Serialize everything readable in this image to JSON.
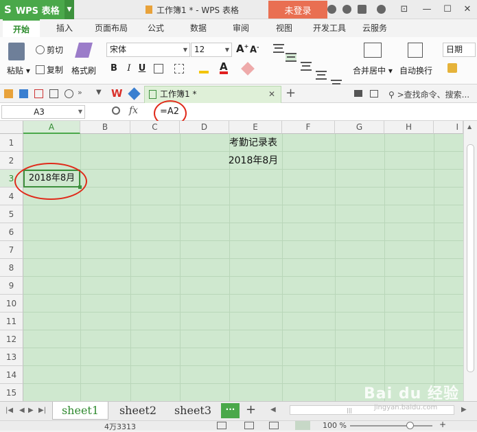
{
  "app": {
    "name": "WPS 表格",
    "logo_glyph": "S",
    "document_title": "工作簿1 * - WPS 表格",
    "login_label": "未登录"
  },
  "menu_tabs": [
    "开始",
    "插入",
    "页面布局",
    "公式",
    "数据",
    "审阅",
    "视图",
    "开发工具",
    "云服务"
  ],
  "ribbon": {
    "paste_label": "粘贴",
    "cut_label": "剪切",
    "copy_label": "复制",
    "format_painter_label": "格式刷",
    "font_name": "宋体",
    "font_size": "12",
    "grow_font": "A",
    "shrink_font": "A",
    "bold": "B",
    "italic": "I",
    "underline": "U",
    "font_color_glyph": "A",
    "merge_center_label": "合并居中",
    "wrap_text_label": "自动换行",
    "number_format": "日期"
  },
  "quick_access": {
    "doc_tab_label": "工作簿1 *",
    "search_label": ">查找命令、搜索..."
  },
  "formula_bar": {
    "name_box": "A3",
    "fx_label": "fx",
    "formula": "=A2"
  },
  "columns": [
    "A",
    "B",
    "C",
    "D",
    "E",
    "F",
    "G",
    "H",
    "I"
  ],
  "rows": [
    "1",
    "2",
    "3",
    "4",
    "5",
    "6",
    "7",
    "8",
    "9",
    "10",
    "11",
    "12",
    "13",
    "14",
    "15"
  ],
  "cells": {
    "row1": "考勤记录表",
    "row2": "2018年8月",
    "a3": "2018年8月"
  },
  "sheets": [
    "sheet1",
    "sheet2",
    "sheet3"
  ],
  "sheet_more": "···",
  "add_sheet": "+",
  "status": {
    "cell_info": "4万3313",
    "zoom": "100 %"
  },
  "watermark": {
    "text": "Bai du 经验",
    "sub": "jingyan.baidu.com"
  },
  "colors": {
    "accent_green": "#4aa84a",
    "grid_fill": "#cfe8cf",
    "annotation_red": "#e02a1a",
    "login_bg": "#e96f52"
  }
}
